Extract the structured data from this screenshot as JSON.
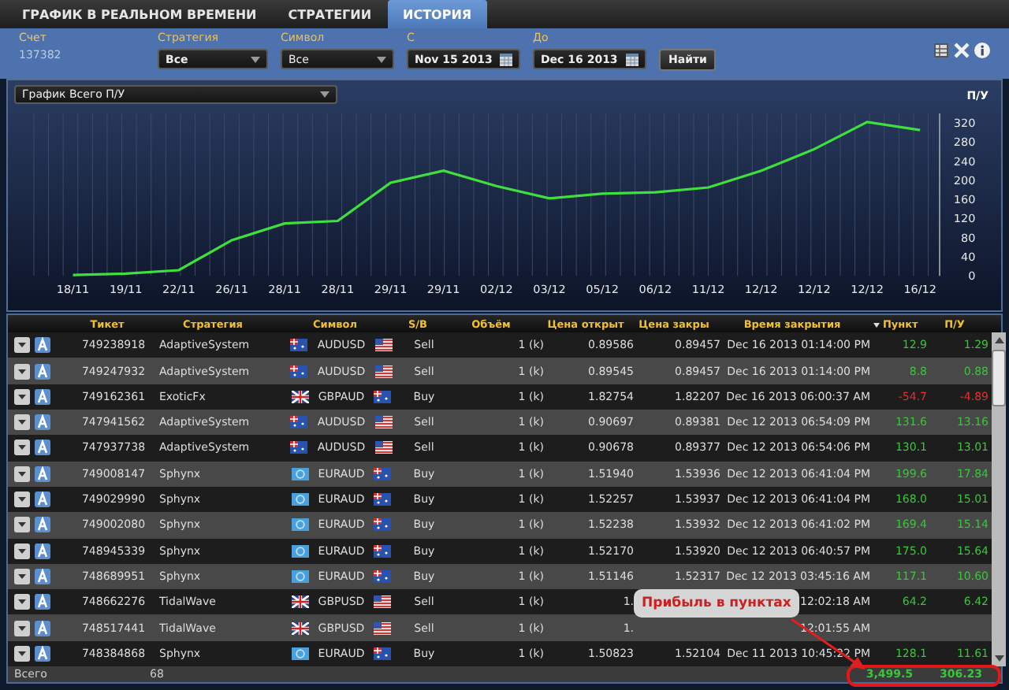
{
  "tabs": [
    {
      "label": "ГРАФИК В РЕАЛЬНОМ ВРЕМЕНИ",
      "selected": false
    },
    {
      "label": "СТРАТЕГИИ",
      "selected": false
    },
    {
      "label": "ИСТОРИЯ",
      "selected": true
    }
  ],
  "filters": {
    "account_label": "Счет",
    "account": "137382",
    "strategy_label": "Стратегия",
    "strategy": "Все",
    "symbol_label": "Символ",
    "symbol": "Все",
    "from_label": "С",
    "from": "Nov 15 2013",
    "to_label": "До",
    "to": "Dec 16 2013",
    "search_button": "Найти"
  },
  "chart_panel": {
    "selector": "График Всего П/У",
    "chart_data": {
      "type": "line",
      "ylabel": "П/У",
      "grid": true,
      "categories": [
        "18/11",
        "19/11",
        "22/11",
        "26/11",
        "28/11",
        "28/11",
        "29/11",
        "29/11",
        "02/12",
        "03/12",
        "05/12",
        "06/12",
        "11/12",
        "12/12",
        "12/12",
        "12/12",
        "16/12"
      ],
      "ylim": [
        0,
        340
      ],
      "yticks": [
        0,
        40,
        80,
        120,
        160,
        200,
        240,
        280,
        320
      ],
      "series": [
        {
          "color": "#3ee03e",
          "values": [
            2,
            5,
            12,
            75,
            110,
            115,
            195,
            220,
            188,
            162,
            172,
            175,
            185,
            220,
            265,
            322,
            305
          ]
        }
      ]
    }
  },
  "table": {
    "columns": [
      "Тикет",
      "Стратегия",
      "Символ",
      "S/B",
      "Объём",
      "Цена открыт",
      "Цена закры",
      "Время закрытия",
      "Пункт",
      "П/У"
    ],
    "rows": [
      {
        "ticket": "749238918",
        "strategy": "AdaptiveSystem",
        "flag_left": {
          "kind": "au"
        },
        "symbol": "AUDUSD",
        "flag_right": {
          "kind": "us"
        },
        "side": "Sell",
        "volume": "1 (k)",
        "open": "0.89586",
        "close": "0.89457",
        "time": "Dec 16 2013 01:14:00 PM",
        "points": "12.9",
        "pl": "1.29",
        "negative": false
      },
      {
        "ticket": "749247932",
        "strategy": "AdaptiveSystem",
        "flag_left": {
          "kind": "au"
        },
        "symbol": "AUDUSD",
        "flag_right": {
          "kind": "us"
        },
        "side": "Sell",
        "volume": "1 (k)",
        "open": "0.89545",
        "close": "0.89457",
        "time": "Dec 16 2013 01:14:00 PM",
        "points": "8.8",
        "pl": "0.88",
        "negative": false
      },
      {
        "ticket": "749162361",
        "strategy": "ExoticFx",
        "flag_left": {
          "kind": "gb"
        },
        "symbol": "GBPAUD",
        "flag_right": {
          "kind": "au"
        },
        "side": "Buy",
        "volume": "1 (k)",
        "open": "1.82754",
        "close": "1.82207",
        "time": "Dec 16 2013 06:00:37 AM",
        "points": "-54.7",
        "pl": "-4.89",
        "negative": true
      },
      {
        "ticket": "747941562",
        "strategy": "AdaptiveSystem",
        "flag_left": {
          "kind": "au"
        },
        "symbol": "AUDUSD",
        "flag_right": {
          "kind": "us"
        },
        "side": "Sell",
        "volume": "1 (k)",
        "open": "0.90697",
        "close": "0.89381",
        "time": "Dec 12 2013 06:54:09 PM",
        "points": "131.6",
        "pl": "13.16",
        "negative": false
      },
      {
        "ticket": "747937738",
        "strategy": "AdaptiveSystem",
        "flag_left": {
          "kind": "au"
        },
        "symbol": "AUDUSD",
        "flag_right": {
          "kind": "us"
        },
        "side": "Sell",
        "volume": "1 (k)",
        "open": "0.90678",
        "close": "0.89377",
        "time": "Dec 12 2013 06:54:06 PM",
        "points": "130.1",
        "pl": "13.01",
        "negative": false
      },
      {
        "ticket": "749008147",
        "strategy": "Sphynx",
        "flag_left": {
          "kind": "eu"
        },
        "symbol": "EURAUD",
        "flag_right": {
          "kind": "au"
        },
        "side": "Buy",
        "volume": "1 (k)",
        "open": "1.51940",
        "close": "1.53936",
        "time": "Dec 12 2013 06:41:04 PM",
        "points": "199.6",
        "pl": "17.84",
        "negative": false
      },
      {
        "ticket": "749029990",
        "strategy": "Sphynx",
        "flag_left": {
          "kind": "eu"
        },
        "symbol": "EURAUD",
        "flag_right": {
          "kind": "au"
        },
        "side": "Buy",
        "volume": "1 (k)",
        "open": "1.52257",
        "close": "1.53937",
        "time": "Dec 12 2013 06:41:04 PM",
        "points": "168.0",
        "pl": "15.01",
        "negative": false
      },
      {
        "ticket": "749002080",
        "strategy": "Sphynx",
        "flag_left": {
          "kind": "eu"
        },
        "symbol": "EURAUD",
        "flag_right": {
          "kind": "au"
        },
        "side": "Buy",
        "volume": "1 (k)",
        "open": "1.52238",
        "close": "1.53932",
        "time": "Dec 12 2013 06:41:02 PM",
        "points": "169.4",
        "pl": "15.14",
        "negative": false
      },
      {
        "ticket": "748945339",
        "strategy": "Sphynx",
        "flag_left": {
          "kind": "eu"
        },
        "symbol": "EURAUD",
        "flag_right": {
          "kind": "au"
        },
        "side": "Buy",
        "volume": "1 (k)",
        "open": "1.52170",
        "close": "1.53920",
        "time": "Dec 12 2013 06:40:57 PM",
        "points": "175.0",
        "pl": "15.64",
        "negative": false
      },
      {
        "ticket": "748689951",
        "strategy": "Sphynx",
        "flag_left": {
          "kind": "eu"
        },
        "symbol": "EURAUD",
        "flag_right": {
          "kind": "au"
        },
        "side": "Buy",
        "volume": "1 (k)",
        "open": "1.51146",
        "close": "1.52317",
        "time": "Dec 12 2013 03:45:16 AM",
        "points": "117.1",
        "pl": "10.60",
        "negative": false
      },
      {
        "ticket": "748662276",
        "strategy": "TidalWave",
        "flag_left": {
          "kind": "gb"
        },
        "symbol": "GBPUSD",
        "flag_right": {
          "kind": "us"
        },
        "side": "Sell",
        "volume": "1 (k)",
        "open": "1.",
        "time": "12:02:18 AM",
        "points": "64.2",
        "pl": "6.42",
        "negative": false
      },
      {
        "ticket": "748517441",
        "strategy": "TidalWave",
        "flag_left": {
          "kind": "gb"
        },
        "symbol": "GBPUSD",
        "flag_right": {
          "kind": "us"
        },
        "side": "Sell",
        "volume": "1 (k)",
        "open": "1.",
        "time": "12:01:55 AM"
      },
      {
        "ticket": "748384868",
        "strategy": "Sphynx",
        "flag_left": {
          "kind": "eu"
        },
        "symbol": "EURAUD",
        "flag_right": {
          "kind": "au"
        },
        "side": "Buy",
        "volume": "1 (k)",
        "open": "1.50823",
        "close": "1.52104",
        "time": "Dec 11 2013 10:45:22 PM",
        "points": "128.1",
        "pl": "11.61",
        "negative": false
      }
    ],
    "footer": {
      "label": "Всего",
      "count": "68",
      "points": "3,499.5",
      "pl": "306.23"
    }
  },
  "callout": "Прибыль в пунктах"
}
